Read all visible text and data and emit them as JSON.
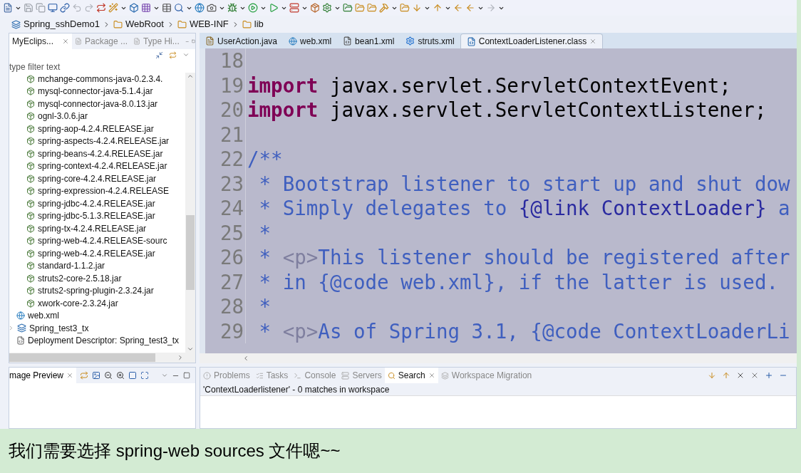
{
  "breadcrumb": [
    {
      "label": "Spring_sshDemo1",
      "kind": "project"
    },
    {
      "label": "WebRoot",
      "kind": "folder"
    },
    {
      "label": "WEB-INF",
      "kind": "folder"
    },
    {
      "label": "lib",
      "kind": "folder"
    }
  ],
  "left_panel": {
    "tabs": [
      {
        "label": "MyEclips...",
        "selected": true
      },
      {
        "label": "Package ...",
        "selected": false
      },
      {
        "label": "Type Hi...",
        "selected": false
      }
    ],
    "filter": {
      "placeholder": "type filter text"
    },
    "tree": [
      {
        "children": [
          {
            "children": [
              {
                "label": "mchange-commons-java-0.2.3.4.",
                "kind": "jar"
              },
              {
                "label": "mysql-connector-java-5.1.4.jar",
                "kind": "jar"
              },
              {
                "label": "mysql-connector-java-8.0.13.jar",
                "kind": "jar"
              },
              {
                "label": "ognl-3.0.6.jar",
                "kind": "jar"
              },
              {
                "label": "spring-aop-4.2.4.RELEASE.jar",
                "kind": "jar"
              },
              {
                "label": "spring-aspects-4.2.4.RELEASE.jar",
                "kind": "jar"
              },
              {
                "label": "spring-beans-4.2.4.RELEASE.jar",
                "kind": "jar"
              },
              {
                "label": "spring-context-4.2.4.RELEASE.jar",
                "kind": "jar"
              },
              {
                "label": "spring-core-4.2.4.RELEASE.jar",
                "kind": "jar"
              },
              {
                "label": "spring-expression-4.2.4.RELEASE",
                "kind": "jar"
              },
              {
                "label": "spring-jdbc-4.2.4.RELEASE.jar",
                "kind": "jar"
              },
              {
                "label": "spring-jdbc-5.1.3.RELEASE.jar",
                "kind": "jar"
              },
              {
                "label": "spring-tx-4.2.4.RELEASE.jar",
                "kind": "jar"
              },
              {
                "label": "spring-web-4.2.4.RELEASE-sourc",
                "kind": "jar"
              },
              {
                "label": "spring-web-4.2.4.RELEASE.jar",
                "kind": "jar"
              },
              {
                "label": "standard-1.1.2.jar",
                "kind": "jar"
              },
              {
                "label": "struts2-core-2.5.18.jar",
                "kind": "jar"
              },
              {
                "label": "struts2-spring-plugin-2.3.24.jar",
                "kind": "jar"
              },
              {
                "label": "xwork-core-2.3.24.jar",
                "kind": "jar"
              }
            ]
          },
          {
            "label": "web.xml",
            "kind": "xml"
          }
        ]
      },
      {
        "label": "Spring_test3_tx",
        "kind": "project",
        "children": [
          {
            "label": "Deployment Descriptor: Spring_test3_tx",
            "kind": "descriptor"
          }
        ]
      }
    ]
  },
  "editor": {
    "tabs": [
      {
        "label": "UserAction.java",
        "kind": "java",
        "selected": false
      },
      {
        "label": "web.xml",
        "kind": "xml",
        "selected": false
      },
      {
        "label": "bean1.xml",
        "kind": "bean",
        "selected": false
      },
      {
        "label": "struts.xml",
        "kind": "gear",
        "selected": false
      },
      {
        "label": "ContextLoaderListener.class",
        "kind": "class",
        "selected": true
      }
    ],
    "lines": [
      {
        "number": "18"
      },
      {
        "number": "19",
        "segments": [
          {
            "kind": "keyword",
            "text": "import"
          },
          {
            "kind": "plain",
            "text": " javax.servlet.ServletContextEvent;"
          }
        ]
      },
      {
        "number": "20",
        "segments": [
          {
            "kind": "keyword",
            "text": "import"
          },
          {
            "kind": "plain",
            "text": " javax.servlet.ServletContextListener;"
          }
        ]
      },
      {
        "number": "21"
      },
      {
        "number": "22",
        "segments": [
          {
            "kind": "doc",
            "text": "/**"
          }
        ]
      },
      {
        "number": "23",
        "segments": [
          {
            "kind": "doc",
            "text": " * Bootstrap listener to start up and shut dow"
          }
        ]
      },
      {
        "number": "24",
        "segments": [
          {
            "kind": "doc",
            "text": " * Simply delegates to "
          },
          {
            "kind": "doctag",
            "text": "{@link ContextLoader}"
          },
          {
            "kind": "doc",
            "text": " a"
          }
        ]
      },
      {
        "number": "25",
        "segments": [
          {
            "kind": "doc",
            "text": " *"
          }
        ]
      },
      {
        "number": "26",
        "segments": [
          {
            "kind": "doc",
            "text": " * "
          },
          {
            "kind": "html",
            "text": "<p>"
          },
          {
            "kind": "doc",
            "text": "This listener should be registered after"
          }
        ]
      },
      {
        "number": "27",
        "segments": [
          {
            "kind": "doc",
            "text": " * in {@code web.xml}, if the latter is used."
          }
        ]
      },
      {
        "number": "28",
        "segments": [
          {
            "kind": "doc",
            "text": " *"
          }
        ]
      },
      {
        "number": "29",
        "segments": [
          {
            "kind": "doc",
            "text": " * "
          },
          {
            "kind": "html",
            "text": "<p>"
          },
          {
            "kind": "doc",
            "text": "As of Spring 3.1, {@code ContextLoaderLi"
          }
        ]
      }
    ]
  },
  "preview_panel": {
    "tab": {
      "label": "mage Preview",
      "selected": true
    }
  },
  "bottom_panel": {
    "tabs": [
      {
        "label": "Problems",
        "selected": false
      },
      {
        "label": "Tasks",
        "selected": false
      },
      {
        "label": "Console",
        "selected": false
      },
      {
        "label": "Servers",
        "selected": false
      },
      {
        "label": "Search",
        "selected": true
      },
      {
        "label": "Workspace Migration",
        "selected": false
      }
    ],
    "status": "'ContextLoaderlistener' - 0 matches in workspace"
  },
  "caption": "我们需要选择 spring-web sources 文件嗯~~"
}
